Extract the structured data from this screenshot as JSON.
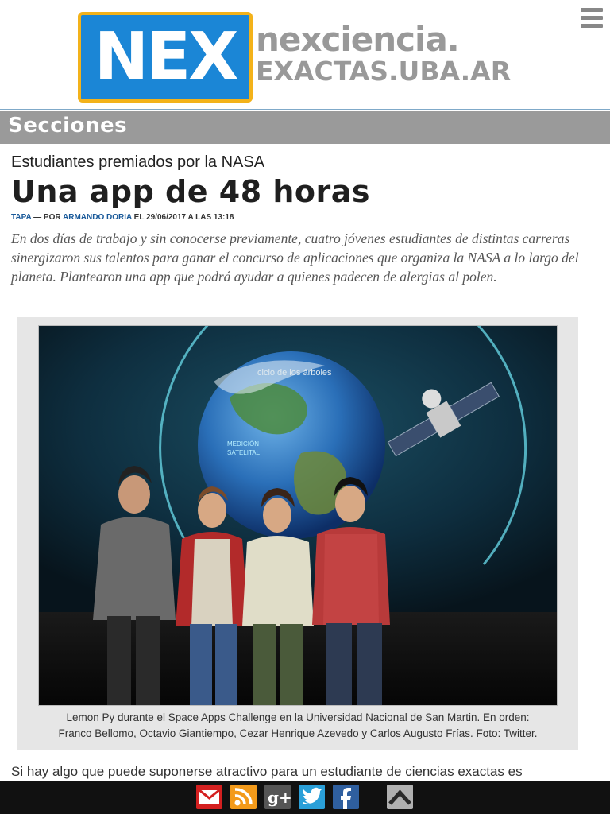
{
  "header": {
    "logo_text": "NEX",
    "site_name_line1": "nexciencia.",
    "site_name_line2": "EXACTAS.UBA.AR"
  },
  "sections": {
    "label": "Secciones"
  },
  "article": {
    "kicker": "Estudiantes premiados por la NASA",
    "title": "Una app de 48 horas",
    "category": "TAPA",
    "by_label": "— POR",
    "author": "ARMANDO DORIA",
    "date_label": "EL 29/06/2017 A LAS 13:18",
    "lead": "En dos días de trabajo y sin conocerse previamente, cuatro jóvenes estudiantes de distintas carreras sinergizaron sus talentos para ganar el concurso de aplicaciones que organiza la NASA a lo largo del planeta. Plantearon una app que podrá ayudar a quienes padecen de alergias al polen.",
    "photo_text": {
      "ciclo": "ciclo de los árboles",
      "medicion_1": "MEDICIÓN",
      "medicion_2": "SATELITAL"
    },
    "caption_line1": "Lemon Py durante el Space Apps Challenge en la Universidad Nacional de San Martin. En orden:",
    "caption_line2": "Franco Bellomo, Octavio Giantiempo, Cezar Henrique Azevedo y Carlos Augusto Frías. Foto: Twitter.",
    "body_start": "Si hay algo que puede suponerse atractivo para un estudiante de ciencias exactas es"
  },
  "share_bar": {
    "icons": [
      "mail-icon",
      "rss-icon",
      "google-plus-icon",
      "twitter-icon",
      "facebook-icon",
      "back-to-top-icon"
    ],
    "colors": {
      "mail": "#d42020",
      "rss": "#f39a1a",
      "google_plus": "#555555",
      "twitter": "#2a9fd8",
      "facebook": "#2f5f9f",
      "top": "#b0b0b0"
    }
  },
  "colors": {
    "logo_blue": "#1b86d6",
    "logo_border": "#f3b21a",
    "sections_bar": "#9a9a9a",
    "link_blue": "#1a5a9a"
  }
}
